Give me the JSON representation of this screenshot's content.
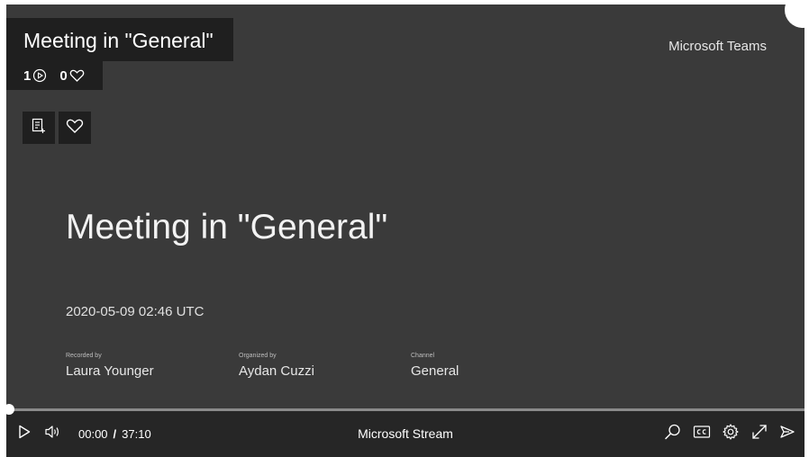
{
  "video": {
    "title": "Meeting in \"General\"",
    "views": "1",
    "likes": "0",
    "brand": "Microsoft Teams"
  },
  "slide": {
    "title": "Meeting in \"General\"",
    "date": "2020-05-09 02:46 UTC",
    "meta": [
      {
        "label": "Recorded by",
        "value": "Laura Younger"
      },
      {
        "label": "Organized by",
        "value": "Aydan Cuzzi"
      },
      {
        "label": "Channel",
        "value": "General"
      }
    ]
  },
  "player": {
    "current_time": "00:00",
    "separator": "/",
    "duration": "37:10",
    "brand": "Microsoft Stream",
    "progress": 0.0
  },
  "icons": {
    "views": "play-circle-icon",
    "likes": "heart-icon",
    "add_to_group": "add-to-list-icon",
    "like_button": "heart-icon",
    "play": "play-icon",
    "volume": "volume-icon",
    "search": "search-icon",
    "captions": "cc-icon",
    "settings": "gear-icon",
    "fullscreen": "expand-icon",
    "share": "share-icon"
  },
  "colors": {
    "background": "#3a3a3a",
    "overlay": "#1f1f1f",
    "control_bar": "#262626"
  }
}
